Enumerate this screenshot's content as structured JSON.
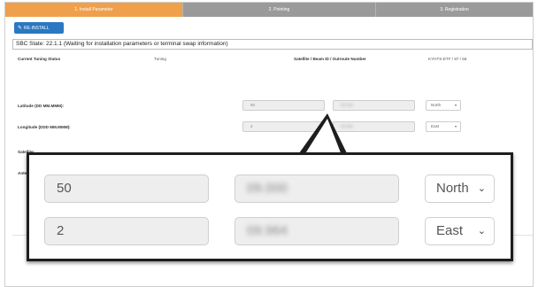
{
  "steps": [
    "1. Install Parameter",
    "2. Pointing",
    "3. Registration"
  ],
  "reinstall_label": "RE-INSTALL",
  "sbc_state": "SBC State: 22.1.1 (Waiting for installation parameters or terminal swap information)",
  "status": {
    "label": "Current Tuning Status",
    "value": "Tuning",
    "beam_label": "Satellite / Beam ID / Outroute Number",
    "beam_value": "KYHTS-ETF / 87 / 66"
  },
  "latitude": {
    "label": "Latitude (DD MM.MMM):",
    "degrees": "50",
    "minutes": "09.000",
    "hemisphere": "North"
  },
  "longitude": {
    "label": "Longitude (DDD MM.MMM):",
    "degrees": "2",
    "minutes": "09.964",
    "hemisphere": "East"
  },
  "satellite_label": "Satellite:",
  "antenna_label": "Antenna:",
  "icons": {
    "reinstall": "wrench-icon",
    "caret": "chevron-down-icon"
  },
  "colors": {
    "active_step": "#f0a04b",
    "inactive_step": "#9a9a9a",
    "button": "#2a78c2",
    "callout_border": "#1e1e1e"
  }
}
